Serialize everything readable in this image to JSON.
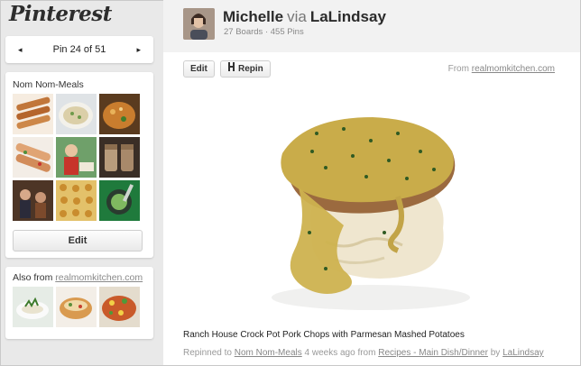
{
  "app": {
    "logo": "Pinterest"
  },
  "pager": {
    "prev_icon": "◂",
    "label": "Pin 24 of 51",
    "next_icon": "▸"
  },
  "board": {
    "title": "Nom Nom-Meals",
    "thumbnails": [
      "food-thumbnail",
      "food-thumbnail",
      "food-thumbnail",
      "food-thumbnail",
      "food-thumbnail",
      "food-thumbnail",
      "food-thumbnail",
      "food-thumbnail",
      "food-thumbnail"
    ],
    "edit_label": "Edit"
  },
  "also_from": {
    "prefix": "Also from",
    "source": "realmomkitchen.com"
  },
  "pinner": {
    "name": "Michelle",
    "via": "via",
    "via_user": "LaLindsay",
    "stats": "27 Boards · 455 Pins"
  },
  "actions": {
    "edit_label": "Edit",
    "repin_label": "Repin",
    "repin_icon": "pin-icon"
  },
  "source": {
    "prefix": "From",
    "domain": "realmomkitchen.com"
  },
  "pin": {
    "description": "Ranch House Crock Pot Pork Chops with Parmesan Mashed Potatoes",
    "repinned_to": "Repinned to",
    "board": "Nom Nom-Meals",
    "time": "4 weeks ago from",
    "from_board": "Recipes - Main Dish/Dinner",
    "by": "by",
    "by_user": "LaLindsay"
  }
}
